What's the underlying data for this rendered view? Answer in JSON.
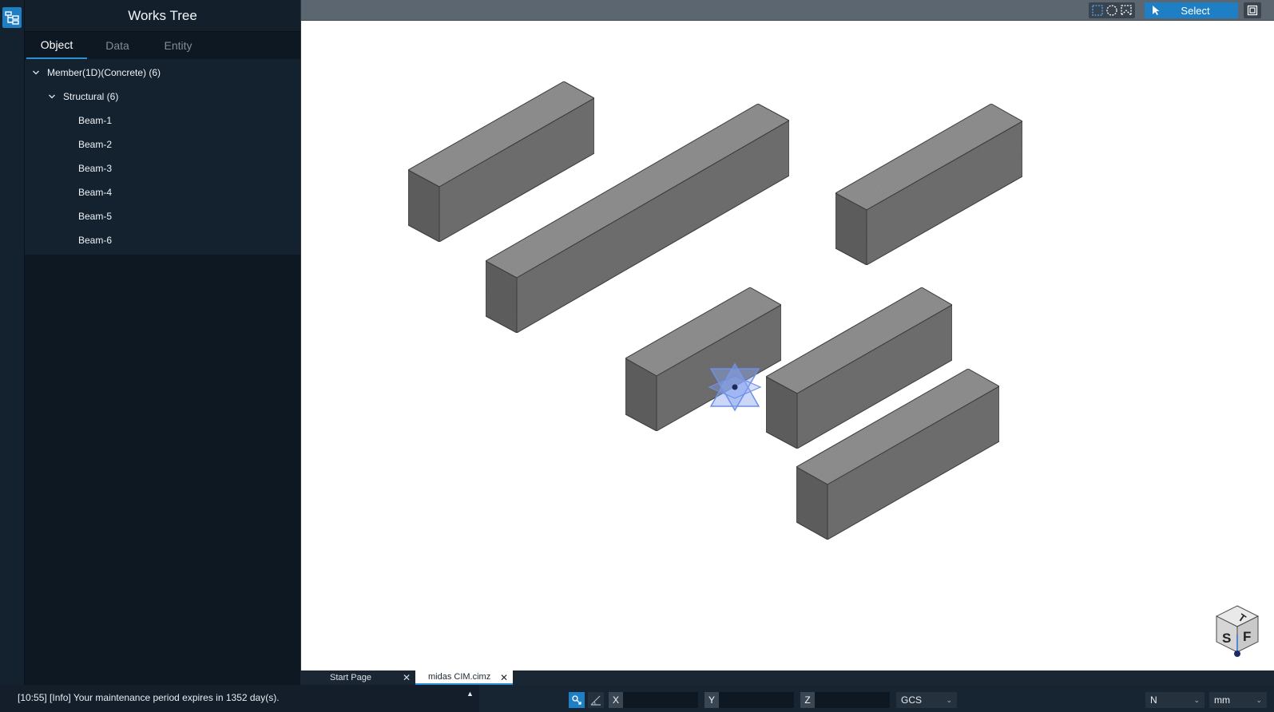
{
  "panel": {
    "title": "Works Tree",
    "tabs": [
      "Object",
      "Data",
      "Entity"
    ],
    "tree": {
      "group": "Member(1D)(Concrete) (6)",
      "subgroup": "Structural (6)",
      "items": [
        "Beam-1",
        "Beam-2",
        "Beam-3",
        "Beam-4",
        "Beam-5",
        "Beam-6"
      ]
    }
  },
  "toolbar": {
    "select_label": "Select"
  },
  "viewcube": {
    "faces": [
      "T",
      "S",
      "F"
    ]
  },
  "document_tabs": [
    "Start Page",
    "midas CIM.cimz"
  ],
  "status": {
    "message": "[10:55] [Info] Your maintenance period expires in 1352 day(s).",
    "coords": {
      "x_label": "X",
      "y_label": "Y",
      "z_label": "Z",
      "x_value": "",
      "y_value": "",
      "z_value": ""
    },
    "coord_system": "GCS",
    "force_unit": "N",
    "length_unit": "mm"
  },
  "colors": {
    "accent": "#1f7fc4",
    "beam_top": "#8e8e8e",
    "beam_left": "#5e5e5e",
    "beam_right": "#6e6e6e",
    "beam_edge": "#3c3c3c"
  }
}
